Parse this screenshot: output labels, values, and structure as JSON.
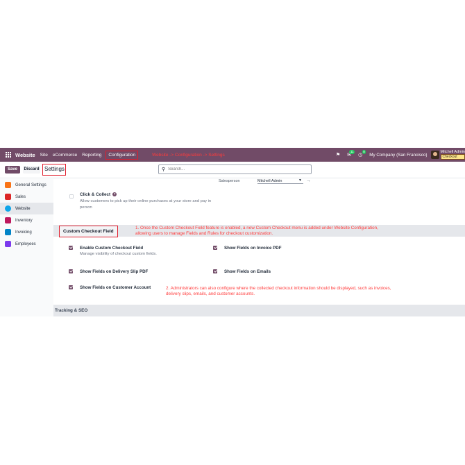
{
  "colors": {
    "brand": "#714b67",
    "annotation": "#ff3b3b",
    "highlight_box": "#e11d2c",
    "section_bg": "#e5e7eb"
  },
  "navbar": {
    "app_name": "Website",
    "menu": [
      "Site",
      "eCommerce",
      "Reporting"
    ],
    "configuration": "Configuration",
    "annotation": "Website -> Configuration -> Settings",
    "messages_badge": "11",
    "activity_badge": "8",
    "company": "My Company (San Francisco)",
    "user_name": "Mitchell Admin",
    "user_db": "Checkout"
  },
  "control": {
    "save_label": "Save",
    "discard_label": "Discard",
    "title": "Settings",
    "search_placeholder": "Search..."
  },
  "sidebar": {
    "items": [
      {
        "label": "General Settings",
        "icon": "settings-app-icon",
        "color": "#f97316"
      },
      {
        "label": "Sales",
        "icon": "sales-app-icon",
        "color": "#dc2626"
      },
      {
        "label": "Website",
        "icon": "website-app-icon",
        "color": "#0ea5e9",
        "active": true
      },
      {
        "label": "Inventory",
        "icon": "inventory-app-icon",
        "color": "#be185d"
      },
      {
        "label": "Invoicing",
        "icon": "invoicing-app-icon",
        "color": "#0284c7"
      },
      {
        "label": "Employees",
        "icon": "employees-app-icon",
        "color": "#7c3aed"
      }
    ]
  },
  "main": {
    "salesperson_label": "Salesperson",
    "salesperson_value": "Mitchell Admin",
    "click_collect": {
      "title": "Click & Collect",
      "description": "Allow customers to pick up their online purchases at your store and pay in person"
    },
    "custom_checkout_section": {
      "title": "Custom Checkout Field",
      "annotation": "1. Once the Custom Checkout Field feature is enabled, a new Custom Checkout menu is added under Website Configuration, allowing users to manage Fields and Rules for checkout customization."
    },
    "options": {
      "enable_custom_checkout": {
        "label": "Enable Custom Checkout Field",
        "desc": "Manage visibility of checkout custom fields.",
        "checked": true
      },
      "invoice_pdf": {
        "label": "Show Fields on Invoice PDF",
        "checked": true
      },
      "delivery_slip": {
        "label": "Show Fields on Delivery Slip PDF",
        "checked": true
      },
      "emails": {
        "label": "Show Fields on Emails",
        "checked": true
      },
      "customer_account": {
        "label": "Show Fields on Customer Account",
        "checked": true
      }
    },
    "annotation_2": "2. Administrators can also configure where the collected checkout information should be displayed, such as invoices, delivery slips, emails, and customer accounts.",
    "tracking_section": {
      "title": "Tracking & SEO"
    }
  }
}
